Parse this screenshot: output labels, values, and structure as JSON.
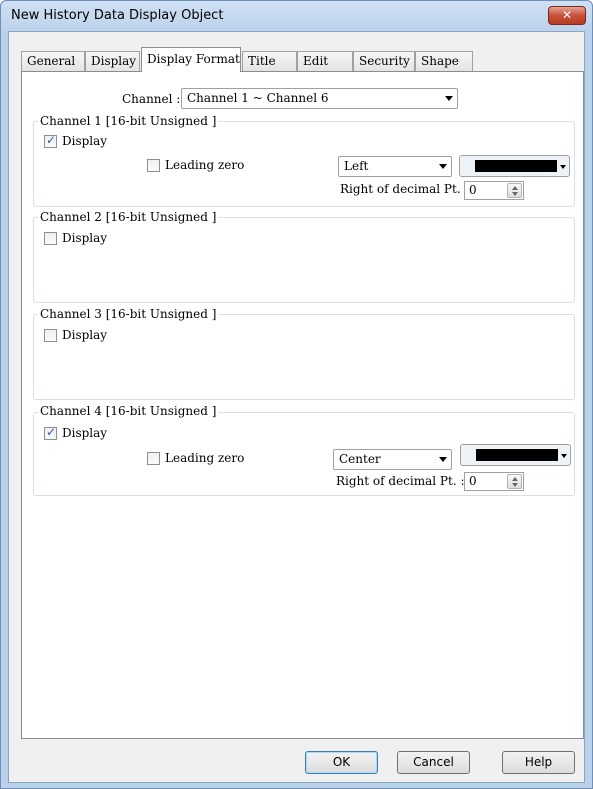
{
  "window": {
    "title": "New History Data Display Object",
    "close_glyph": "✕"
  },
  "tabs": [
    {
      "label": "General"
    },
    {
      "label": "Display"
    },
    {
      "label": "Display Format"
    },
    {
      "label": "Title"
    },
    {
      "label": "Edit"
    },
    {
      "label": "Security"
    },
    {
      "label": "Shape"
    }
  ],
  "channel_select": {
    "label": "Channel :",
    "value": "Channel 1 ~ Channel 6"
  },
  "groups": [
    {
      "title": "Channel 1 [16-bit Unsigned ]",
      "display_label": "Display",
      "display_checked": true,
      "leading_zero_label": "Leading zero",
      "leading_zero_checked": false,
      "align_value": "Left",
      "color": "#000000",
      "decimal_label": "Right of decimal Pt. :",
      "decimal_value": "0"
    },
    {
      "title": "Channel 2 [16-bit Unsigned ]",
      "display_label": "Display",
      "display_checked": false
    },
    {
      "title": "Channel 3 [16-bit Unsigned ]",
      "display_label": "Display",
      "display_checked": false
    },
    {
      "title": "Channel 4 [16-bit Unsigned ]",
      "display_label": "Display",
      "display_checked": true,
      "leading_zero_label": "Leading zero",
      "leading_zero_checked": false,
      "align_value": "Center",
      "color": "#000000",
      "decimal_label": "Right of decimal Pt. :",
      "decimal_value": "0"
    }
  ],
  "buttons": {
    "ok": "OK",
    "cancel": "Cancel",
    "help": "Help"
  },
  "check_glyph": "✓"
}
